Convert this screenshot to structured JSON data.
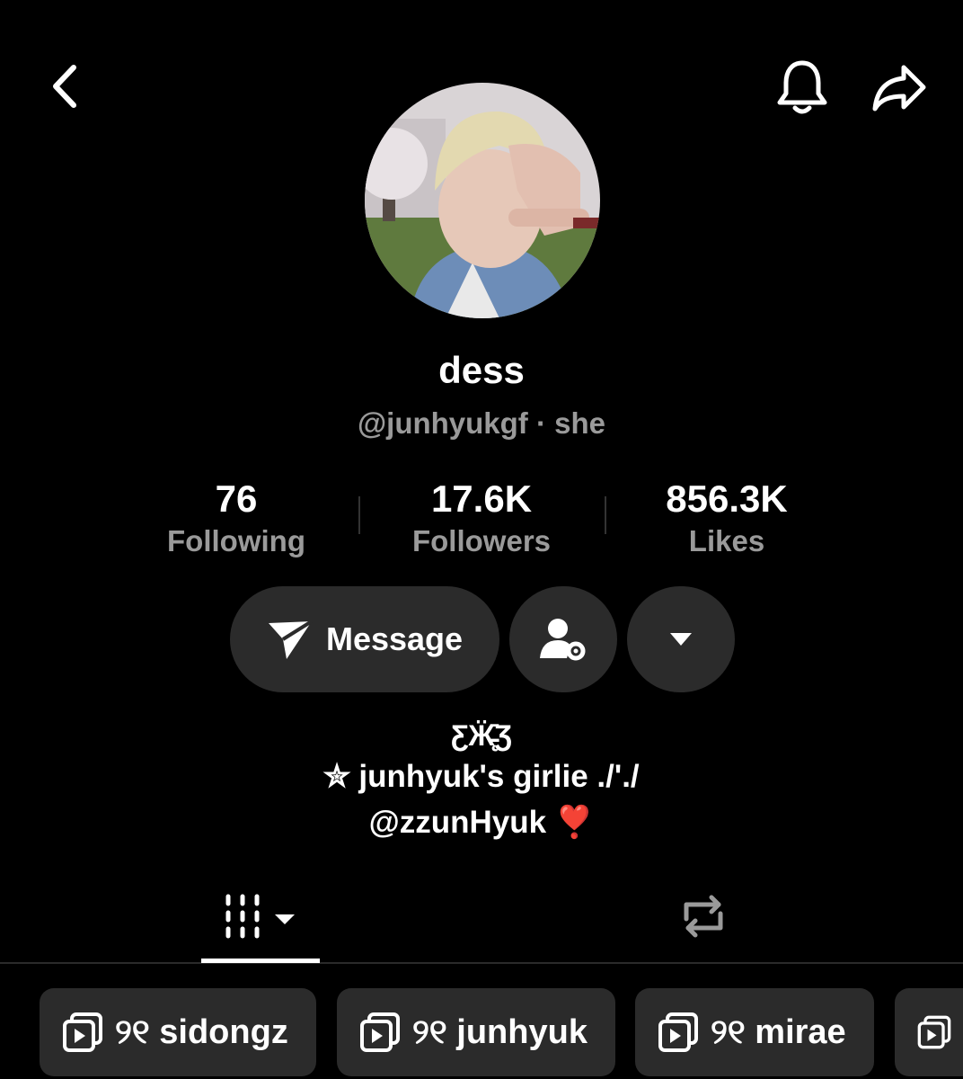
{
  "header": {
    "back_icon": "chevron-left-icon",
    "bell_icon": "bell-icon",
    "share_icon": "share-arrow-icon"
  },
  "profile": {
    "display_name": "dess",
    "handle": "@junhyukgf",
    "pronouns": "· she"
  },
  "stats": [
    {
      "value": "76",
      "label": "Following"
    },
    {
      "value": "17.6K",
      "label": "Followers"
    },
    {
      "value": "856.3K",
      "label": "Likes"
    }
  ],
  "actions": {
    "message_label": "Message",
    "message_icon": "paper-plane-icon",
    "settings_icon": "user-gear-icon",
    "more_icon": "caret-down-icon"
  },
  "bio": {
    "line1": "ƸӜ̵̨̄Ʒ",
    "line2": "✮ junhyuk's girlie ./'./",
    "line3": "@zzunHyuk ❣️"
  },
  "tabs": [
    {
      "name": "videos",
      "icon": "grid-icon",
      "active": true
    },
    {
      "name": "reposts",
      "icon": "repost-icon",
      "active": false
    }
  ],
  "playlists": [
    {
      "label": "୨୧ sidongz"
    },
    {
      "label": "୨୧ junhyuk"
    },
    {
      "label": "୨୧ mirae"
    },
    {
      "label": ""
    }
  ]
}
